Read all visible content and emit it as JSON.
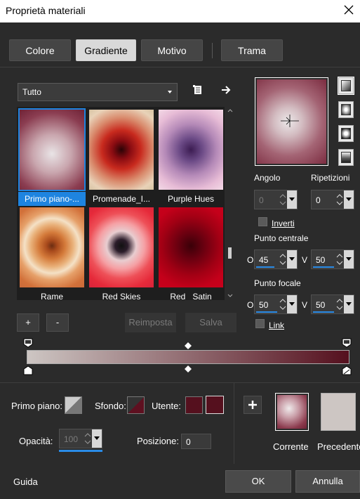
{
  "window": {
    "title": "Proprietà materiali"
  },
  "tabs": [
    {
      "label": "Colore",
      "active": false
    },
    {
      "label": "Gradiente",
      "active": true
    },
    {
      "label": "Motivo",
      "active": false
    },
    {
      "label": "Trama",
      "active": false
    }
  ],
  "library": {
    "filter": "Tutto",
    "items": [
      {
        "label": "Primo piano-...",
        "selected": true
      },
      {
        "label": "Promenade_I...",
        "selected": false
      },
      {
        "label": "Purple Hues",
        "selected": false
      },
      {
        "label": "Rame",
        "selected": false
      },
      {
        "label": "Red Skies",
        "selected": false
      },
      {
        "label": "Red_ Satin",
        "selected": false
      }
    ],
    "add_label": "+",
    "remove_label": "-",
    "reset_label": "Reimposta",
    "save_label": "Salva"
  },
  "settings": {
    "angle_label": "Angolo",
    "angle_value": "0",
    "repeats_label": "Ripetizioni",
    "repeats_value": "0",
    "invert_label": "Inverti",
    "center_label": "Punto centrale",
    "center_h_prefix": "O",
    "center_h": "45",
    "center_v_prefix": "V",
    "center_v": "50",
    "focal_label": "Punto focale",
    "focal_h_prefix": "O",
    "focal_h": "50",
    "focal_v_prefix": "V",
    "focal_v": "50",
    "link_label": "Link"
  },
  "gradient": {
    "start_color": "#cdc6c3",
    "end_color": "#55101e"
  },
  "materials": {
    "fg_label": "Primo piano:",
    "bg_label": "Sfondo:",
    "user_label": "Utente:",
    "opacity_label": "Opacità:",
    "opacity_value": "100",
    "position_label": "Posizione:",
    "position_value": "0",
    "current_label": "Corrente",
    "previous_label": "Precedente",
    "user_color": "#55101e",
    "previous_color": "#cdc6c3"
  },
  "footer": {
    "help_label": "Guida",
    "ok_label": "OK",
    "cancel_label": "Annulla"
  }
}
